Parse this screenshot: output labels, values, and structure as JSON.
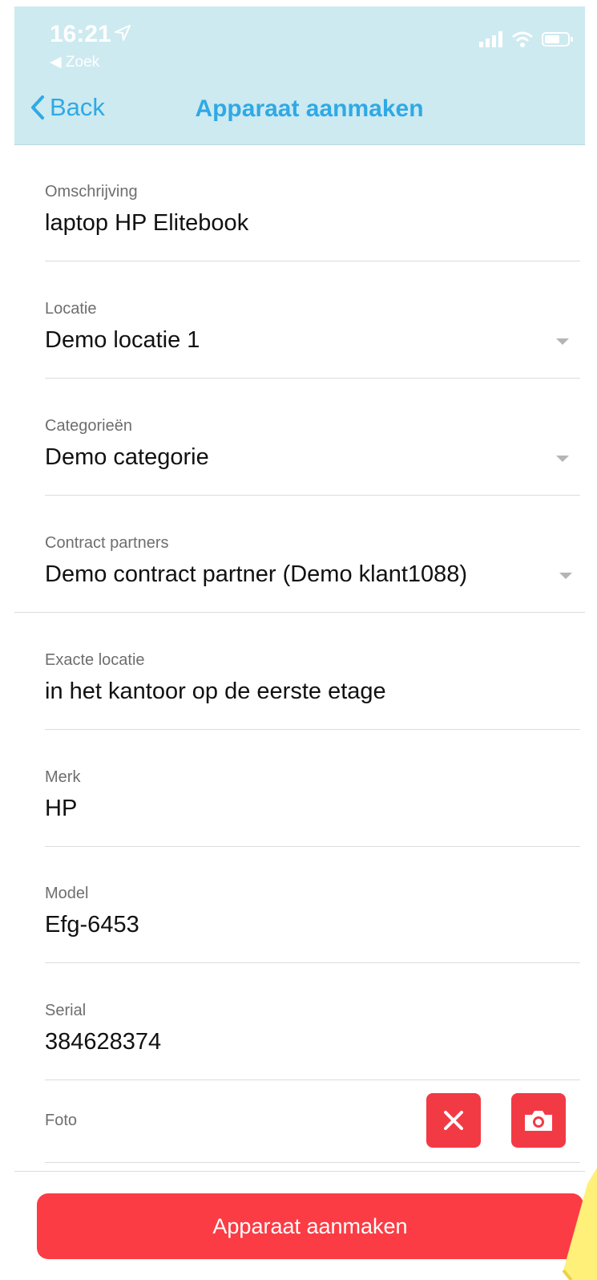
{
  "status_bar": {
    "time": "16:21",
    "back_app": "◀ Zoek"
  },
  "nav": {
    "back_label": "Back",
    "title": "Apparaat aanmaken"
  },
  "fields": {
    "omschrijving": {
      "label": "Omschrijving",
      "value": "laptop HP Elitebook"
    },
    "locatie": {
      "label": "Locatie",
      "value": "Demo locatie 1"
    },
    "categorieen": {
      "label": "Categorieën",
      "value": "Demo categorie"
    },
    "contract_partners": {
      "label": "Contract partners",
      "value": "Demo contract partner (Demo klant1088)"
    },
    "exacte_locatie": {
      "label": "Exacte locatie",
      "value": "in het kantoor op de eerste etage"
    },
    "merk": {
      "label": "Merk",
      "value": "HP"
    },
    "model": {
      "label": "Model",
      "value": "Efg-6453"
    },
    "serial": {
      "label": "Serial",
      "value": "384628374"
    }
  },
  "foto": {
    "label": "Foto"
  },
  "submit_label": "Apparaat aanmaken",
  "colors": {
    "accent": "#2fa9e6",
    "header_bg": "#cdeaf0",
    "danger": "#f23a44",
    "submit": "#fb3c44"
  }
}
